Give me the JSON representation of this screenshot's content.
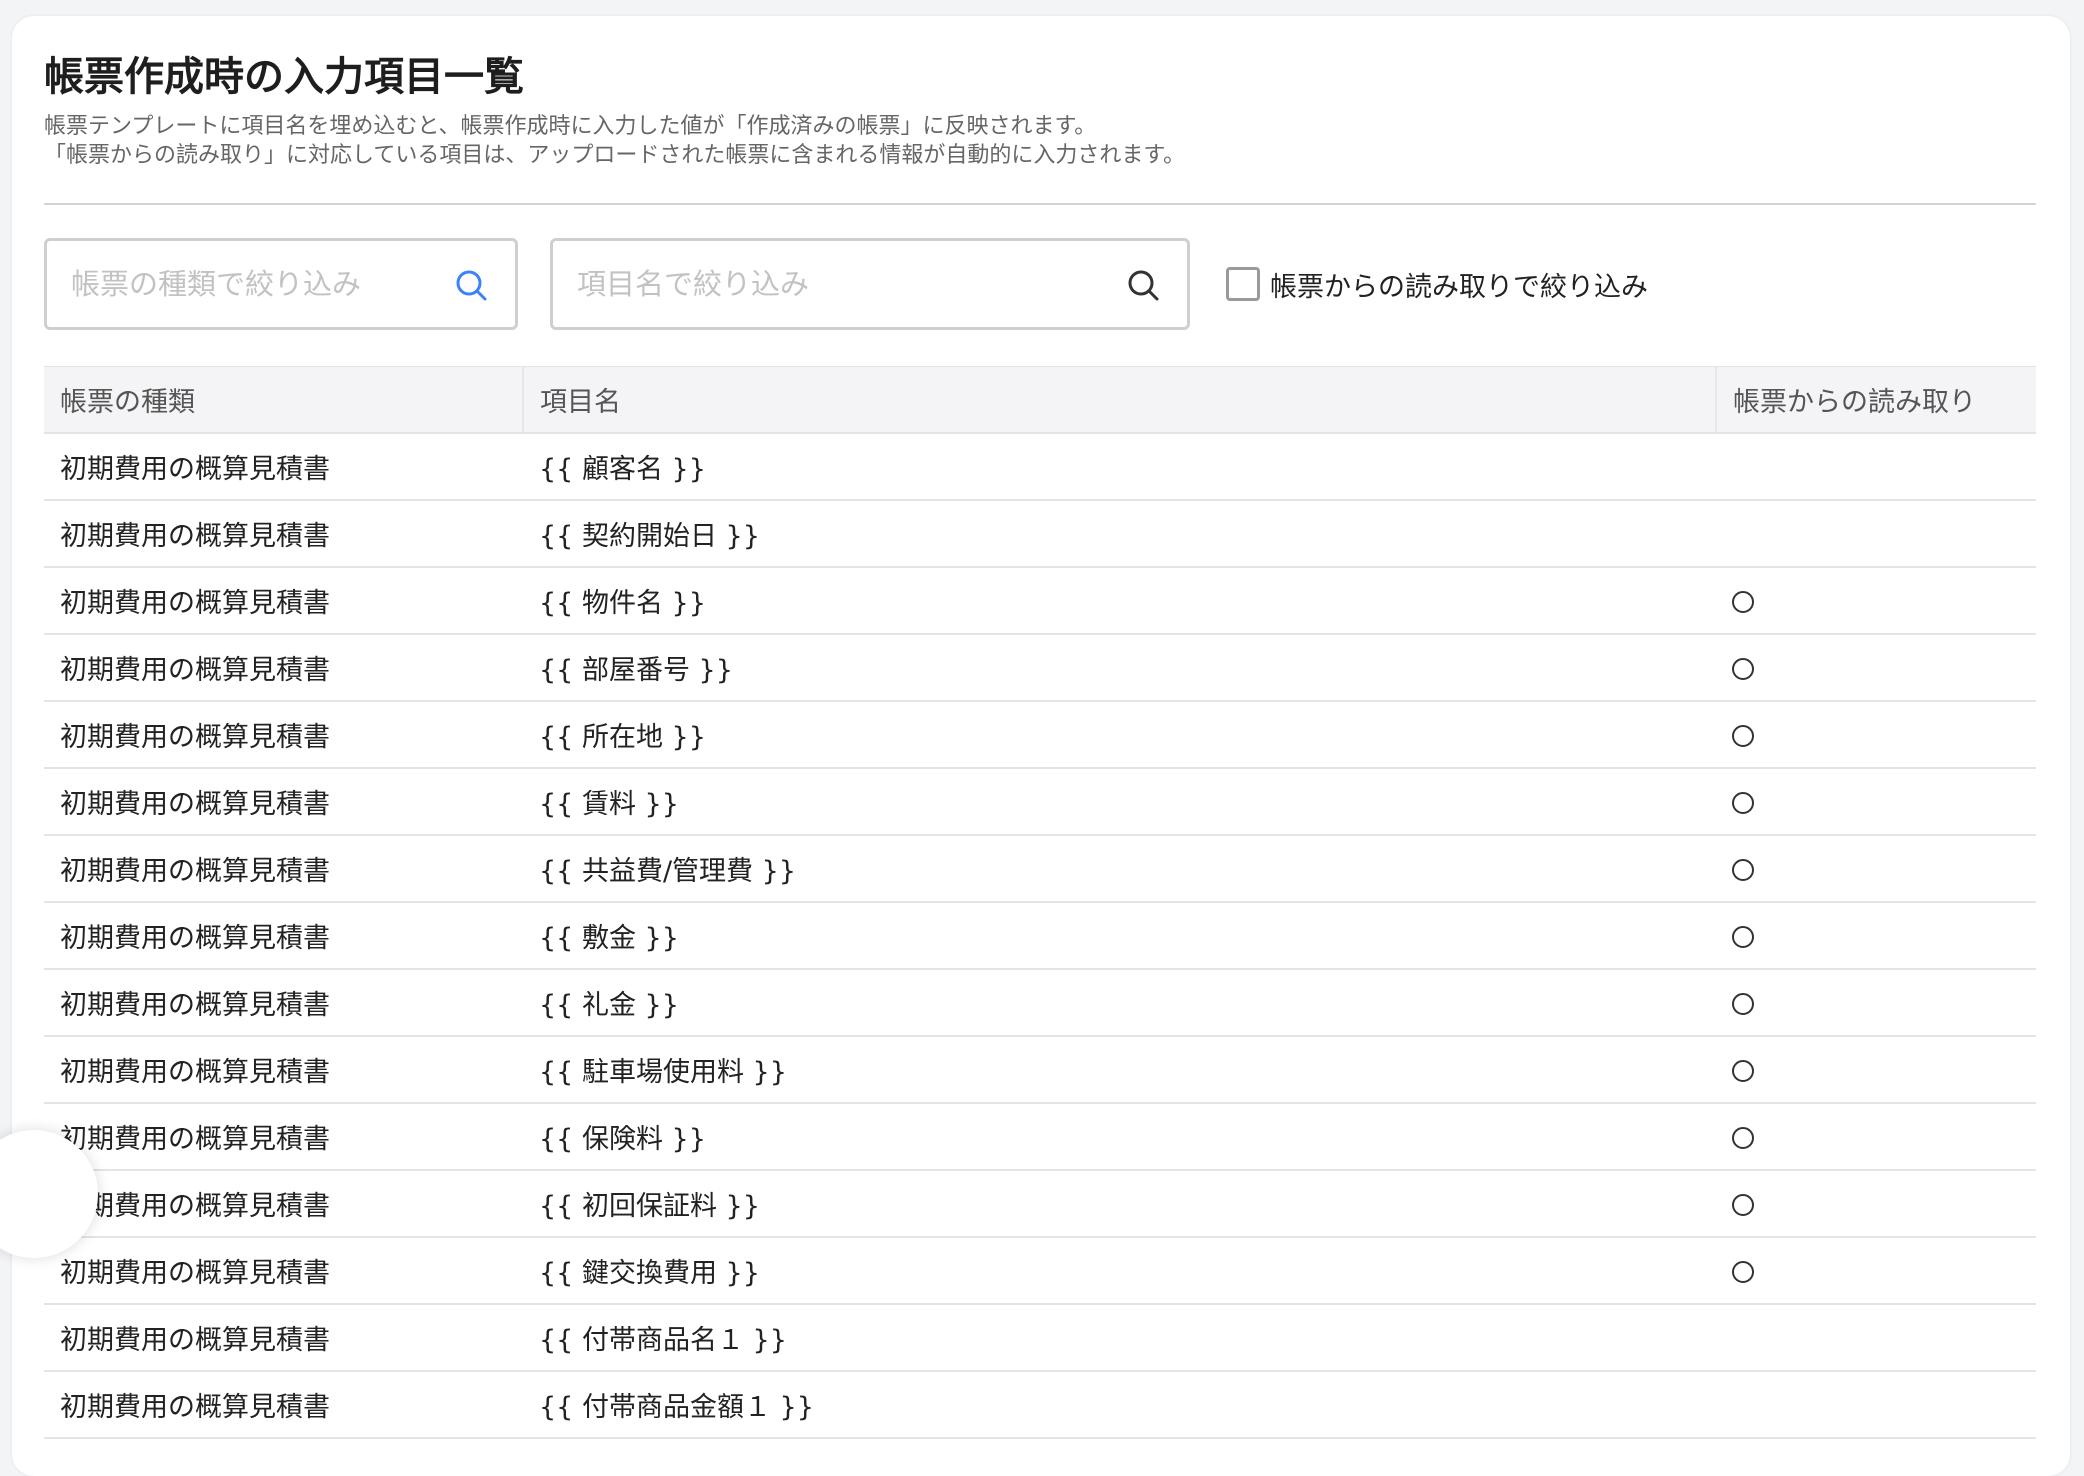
{
  "page": {
    "title": "帳票作成時の入力項目一覧",
    "description_line1": "帳票テンプレートに項目名を埋め込むと、帳票作成時に入力した値が「作成済みの帳票」に反映されます。",
    "description_line2": "「帳票からの読み取り」に対応している項目は、アップロードされた帳票に含まれる情報が自動的に入力されます。"
  },
  "filters": {
    "type_placeholder": "帳票の種類で絞り込み",
    "type_value": "",
    "name_placeholder": "項目名で絞り込み",
    "name_value": "",
    "ocr_checkbox_label": "帳票からの読み取りで絞り込み",
    "ocr_checkbox_checked": false,
    "search_icon_active_color": "#3b82f6",
    "search_icon_color": "#333333"
  },
  "table": {
    "headers": [
      "帳票の種類",
      "項目名",
      "帳票からの読み取り"
    ],
    "rows": [
      {
        "type": "初期費用の概算見積書",
        "name": "{{ 顧客名 }}",
        "ocr": false
      },
      {
        "type": "初期費用の概算見積書",
        "name": "{{ 契約開始日 }}",
        "ocr": false
      },
      {
        "type": "初期費用の概算見積書",
        "name": "{{ 物件名 }}",
        "ocr": true
      },
      {
        "type": "初期費用の概算見積書",
        "name": "{{ 部屋番号 }}",
        "ocr": true
      },
      {
        "type": "初期費用の概算見積書",
        "name": "{{ 所在地 }}",
        "ocr": true
      },
      {
        "type": "初期費用の概算見積書",
        "name": "{{ 賃料 }}",
        "ocr": true
      },
      {
        "type": "初期費用の概算見積書",
        "name": "{{ 共益費/管理費 }}",
        "ocr": true
      },
      {
        "type": "初期費用の概算見積書",
        "name": "{{ 敷金 }}",
        "ocr": true
      },
      {
        "type": "初期費用の概算見積書",
        "name": "{{ 礼金 }}",
        "ocr": true
      },
      {
        "type": "初期費用の概算見積書",
        "name": "{{ 駐車場使用料 }}",
        "ocr": true
      },
      {
        "type": "初期費用の概算見積書",
        "name": "{{ 保険料 }}",
        "ocr": true
      },
      {
        "type": "初期費用の概算見積書",
        "name": "{{ 初回保証料 }}",
        "ocr": true
      },
      {
        "type": "初期費用の概算見積書",
        "name": "{{ 鍵交換費用 }}",
        "ocr": true
      },
      {
        "type": "初期費用の概算見積書",
        "name": "{{ 付帯商品名１ }}",
        "ocr": false
      },
      {
        "type": "初期費用の概算見積書",
        "name": "{{ 付帯商品金額１ }}",
        "ocr": false
      }
    ]
  }
}
